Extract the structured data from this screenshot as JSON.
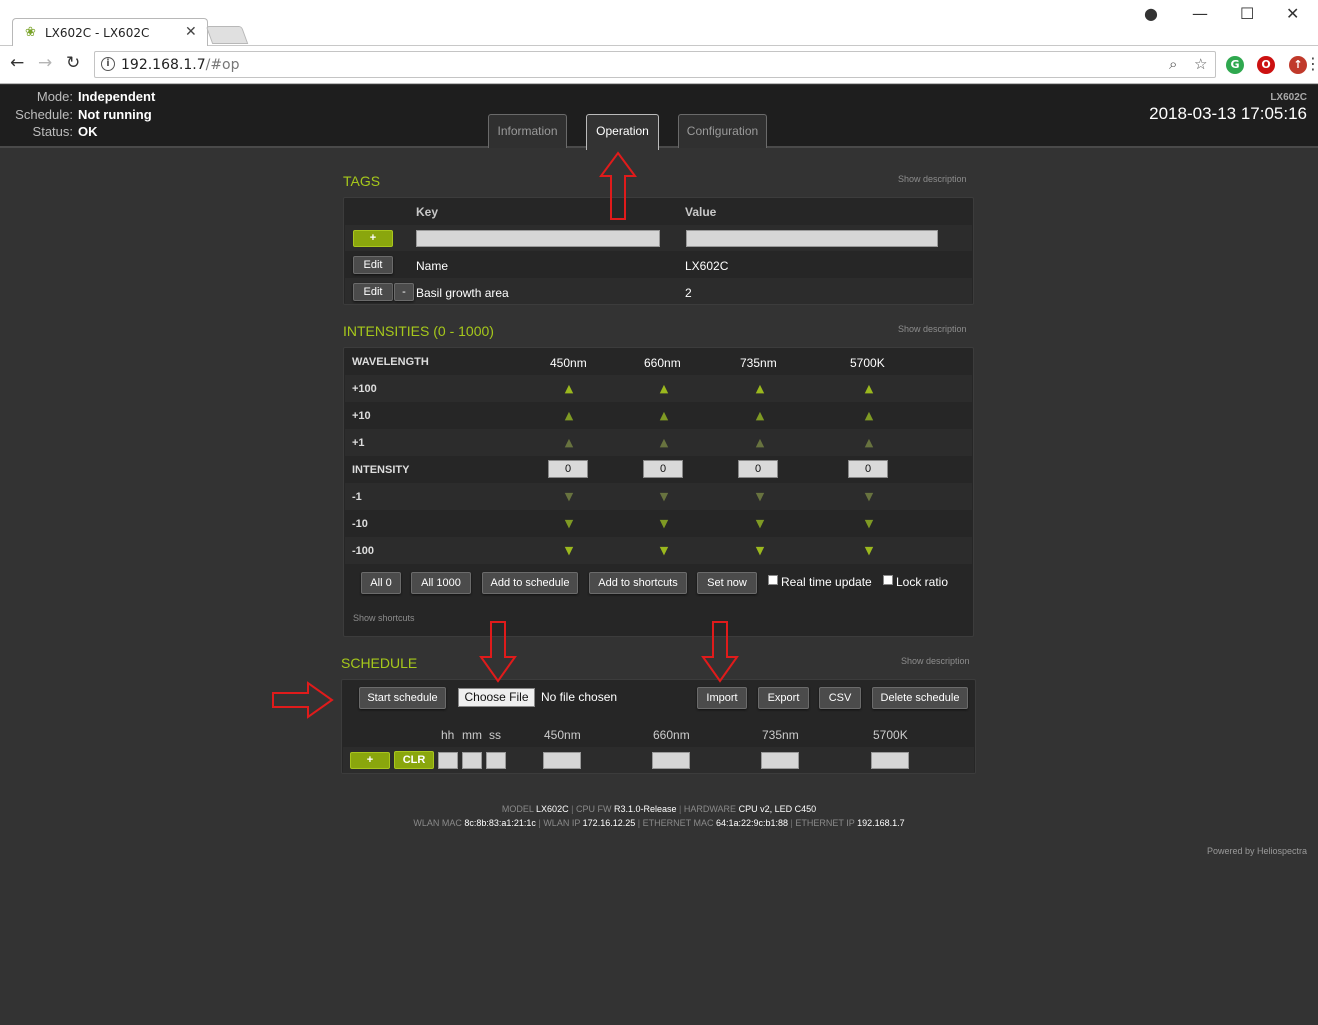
{
  "browser": {
    "tab_title": "LX602C - LX602C",
    "tab_favicon": "leaf-icon",
    "url_host": "192.168.1.7",
    "url_path": "/#op"
  },
  "header": {
    "status": [
      {
        "label": "Mode:",
        "value": "Independent"
      },
      {
        "label": "Schedule:",
        "value": "Not running"
      },
      {
        "label": "Status:",
        "value": "OK"
      }
    ],
    "tabs": [
      {
        "label": "Information",
        "active": false
      },
      {
        "label": "Operation",
        "active": true
      },
      {
        "label": "Configuration",
        "active": false
      }
    ],
    "device_name": "LX602C",
    "datetime": "2018-03-13 17:05:16"
  },
  "tags": {
    "title": "TAGS",
    "show_description": "Show description",
    "col_key": "Key",
    "col_value": "Value",
    "add_label": "+",
    "rows": [
      {
        "edit": "Edit",
        "remove": "",
        "key": "Name",
        "value": "LX602C"
      },
      {
        "edit": "Edit",
        "remove": "-",
        "key": "Basil growth area",
        "value": "2"
      }
    ]
  },
  "intensities": {
    "title": "INTENSITIES (0 - 1000)",
    "show_description": "Show description",
    "wavelength_label": "WAVELENGTH",
    "intensity_label": "INTENSITY",
    "wavelengths": [
      "450nm",
      "660nm",
      "735nm",
      "5700K"
    ],
    "values": [
      "0",
      "0",
      "0",
      "0"
    ],
    "row_labels": {
      "p100": "+100",
      "p10": "+10",
      "p1": "+1",
      "m1": "-1",
      "m10": "-10",
      "m100": "-100"
    },
    "buttons": {
      "all0": "All 0",
      "all1000": "All 1000",
      "add_schedule": "Add to schedule",
      "add_shortcuts": "Add to shortcuts",
      "set_now": "Set now"
    },
    "checks": {
      "realtime": "Real time update",
      "lock_ratio": "Lock ratio"
    },
    "show_shortcuts": "Show shortcuts"
  },
  "schedule": {
    "title": "SCHEDULE",
    "show_description": "Show description",
    "start": "Start schedule",
    "choose_file": "Choose File",
    "no_file": "No file chosen",
    "import": "Import",
    "export": "Export",
    "csv": "CSV",
    "delete": "Delete schedule",
    "col_hh": "hh",
    "col_mm": "mm",
    "col_ss": "ss",
    "wavelengths": [
      "450nm",
      "660nm",
      "735nm",
      "5700K"
    ],
    "add": "+",
    "clr": "CLR"
  },
  "footer": {
    "model_label": "MODEL",
    "model": "LX602C",
    "cpufw_label": "CPU FW",
    "cpufw": "R3.1.0-Release",
    "hw_label": "HARDWARE",
    "hw": "CPU v2, LED C450",
    "wlan_mac_label": "WLAN MAC",
    "wlan_mac": "8c:8b:83:a1:21:1c",
    "wlan_ip_label": "WLAN IP",
    "wlan_ip": "172.16.12.25",
    "eth_mac_label": "ETHERNET MAC",
    "eth_mac": "64:1a:22:9c:b1:88",
    "eth_ip_label": "ETHERNET IP",
    "eth_ip": "192.168.1.7",
    "powered": "Powered by Heliospectra"
  },
  "colors": {
    "accent": "#a6c81b",
    "button_green": "#8aa60d",
    "annotation": "#e01b1b"
  }
}
